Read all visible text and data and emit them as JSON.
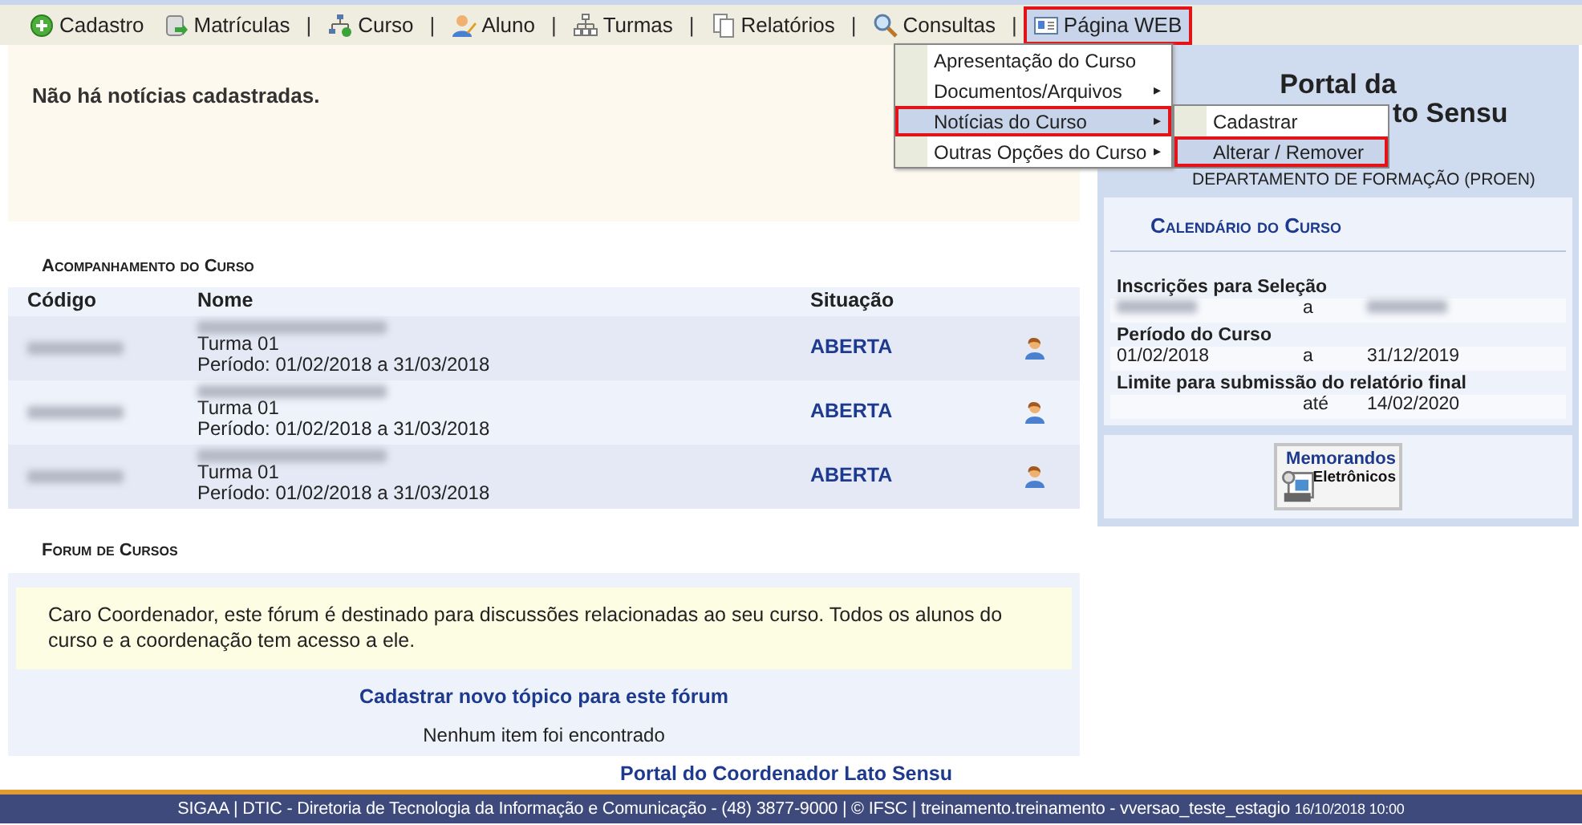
{
  "toolbar": [
    {
      "kind": "menu",
      "label": "Cadastro",
      "annotated": false
    },
    {
      "kind": "menu",
      "label": "Matrículas",
      "annotated": false
    },
    {
      "kind": "separator",
      "label": "|"
    },
    {
      "kind": "menu",
      "label": "Curso",
      "annotated": false
    },
    {
      "kind": "separator",
      "label": "|"
    },
    {
      "kind": "menu",
      "label": "Aluno",
      "annotated": false
    },
    {
      "kind": "separator",
      "label": "|"
    },
    {
      "kind": "menu",
      "label": "Turmas",
      "annotated": false
    },
    {
      "kind": "separator",
      "label": "|"
    },
    {
      "kind": "menu",
      "label": "Relatórios",
      "annotated": false
    },
    {
      "kind": "separator",
      "label": "|"
    },
    {
      "kind": "menu",
      "label": "Consultas",
      "annotated": false
    },
    {
      "kind": "separator",
      "label": "|"
    },
    {
      "kind": "menu",
      "label": "Página WEB",
      "annotated": true
    }
  ],
  "dropdown": [
    {
      "label": "Apresentação do Curso",
      "has_submenu": false,
      "selected": false,
      "annotated": false
    },
    {
      "label": "Documentos/Arquivos",
      "has_submenu": true,
      "selected": false,
      "annotated": false
    },
    {
      "label": "Notícias do Curso",
      "has_submenu": true,
      "selected": true,
      "annotated": true
    },
    {
      "label": "Outras Opções do Curso",
      "has_submenu": true,
      "selected": false,
      "annotated": false
    }
  ],
  "submenu_arrow": "▸",
  "submenu": [
    {
      "label": "Cadastrar",
      "selected": false,
      "annotated": false
    },
    {
      "label": "Alterar / Remover",
      "selected": true,
      "annotated": true
    }
  ],
  "news": {
    "message": "Não há notícias cadastradas."
  },
  "tracking": {
    "title": "Acompanhamento do Curso",
    "columns": [
      "Código",
      "Nome",
      "Situação"
    ],
    "rows": [
      {
        "turma": "Turma 01",
        "periodo": "Período: 01/02/2018 a 31/03/2018",
        "status": "ABERTA"
      },
      {
        "turma": "Turma 01",
        "periodo": "Período: 01/02/2018 a 31/03/2018",
        "status": "ABERTA"
      },
      {
        "turma": "Turma 01",
        "periodo": "Período: 01/02/2018 a 31/03/2018",
        "status": "ABERTA"
      }
    ]
  },
  "forum": {
    "title": "Forum de Cursos",
    "note": "Caro Coordenador, este fórum é destinado para discussões relacionadas ao seu curso. Todos os alunos do curso e a coordenação tem acesso a ele.",
    "link": "Cadastrar novo tópico para este fórum",
    "empty": "Nenhum item foi encontrado"
  },
  "portal": {
    "title": "Portal da",
    "title_visible_end": "to Sensu",
    "department": "DEPARTAMENTO DE FORMAÇÃO (PROEN)"
  },
  "calendar": {
    "title": "Calendário do Curso",
    "groups": [
      {
        "label": "Inscrições para Seleção",
        "cells": [
          {
            "kind": "redacted"
          },
          {
            "kind": "text",
            "text": "a"
          },
          {
            "kind": "redacted"
          }
        ]
      },
      {
        "label": "Período do Curso",
        "cells": [
          {
            "kind": "text",
            "text": "01/02/2018"
          },
          {
            "kind": "text",
            "text": "a"
          },
          {
            "kind": "text",
            "text": "31/12/2019"
          }
        ]
      },
      {
        "label": "Limite para submissão do relatório final",
        "cells": [
          {
            "kind": "empty"
          },
          {
            "kind": "text",
            "text": "até"
          },
          {
            "kind": "text",
            "text": "14/02/2020"
          }
        ]
      }
    ]
  },
  "memorandos": {
    "line_1": "Memorandos",
    "line_2": "Eletrônicos"
  },
  "footer_link": "Portal do Coordenador Lato Sensu",
  "status_bar": {
    "text": "SIGAA | DTIC - Diretoria de Tecnologia da Informação e Comunicação - (48) 3877-9000 | © IFSC | treinamento.treinamento - vversao_teste_estagio",
    "timestamp": "16/10/2018 10:00"
  }
}
